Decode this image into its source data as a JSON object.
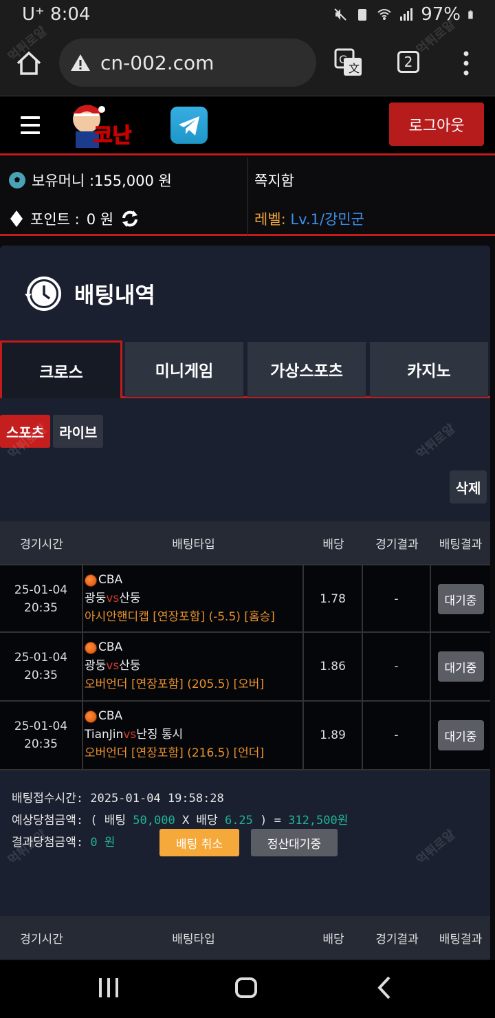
{
  "statusbar": {
    "carrier": "U⁺",
    "time": "8:04",
    "battery": "97%"
  },
  "browser": {
    "url": "cn-002.com",
    "tab_count": "2"
  },
  "header": {
    "logo_text": "코난",
    "logout_label": "로그아웃"
  },
  "user": {
    "money_label": "보유머니 :155,000 원",
    "messages_label": "쪽지함",
    "points_label": "포인트 :",
    "points_value": "0 원",
    "level_label": "레벨:",
    "level_value": "Lv.1/강민군"
  },
  "page": {
    "title": "배팅내역"
  },
  "tabs": [
    {
      "label": "크로스"
    },
    {
      "label": "미니게임"
    },
    {
      "label": "가상스포츠"
    },
    {
      "label": "카지노"
    }
  ],
  "subtabs": [
    {
      "label": "스포츠"
    },
    {
      "label": "라이브"
    }
  ],
  "delete_label": "삭제",
  "columns": [
    "경기시간",
    "배팅타입",
    "배당",
    "경기결과",
    "배팅결과"
  ],
  "bets": [
    {
      "date": "25-01-04",
      "time": "20:35",
      "league": "CBA",
      "home": "광둥",
      "vs": "vs",
      "away": "산둥",
      "bet": "아시안핸디캡 [연장포함] (-5.5) [홈승]",
      "odds": "1.78",
      "result": "-",
      "status": "대기중"
    },
    {
      "date": "25-01-04",
      "time": "20:35",
      "league": "CBA",
      "home": "광둥",
      "vs": "vs",
      "away": "산둥",
      "bet": "오버언더 [연장포함] (205.5) [오버]",
      "odds": "1.86",
      "result": "-",
      "status": "대기중"
    },
    {
      "date": "25-01-04",
      "time": "20:35",
      "league": "CBA",
      "home": "TianJin",
      "vs": "vs",
      "away": "난징 통시",
      "bet": "오버언더 [연장포함] (216.5) [언더]",
      "odds": "1.89",
      "result": "-",
      "status": "대기중"
    }
  ],
  "summary": {
    "accepted_label": "배팅접수시간: 2025-01-04 19:58:28",
    "expected_prefix": "예상당첨금액: ( 배팅 ",
    "stake": "50,000",
    "x_label": " X 배당 ",
    "total_odds": "6.25",
    "eq_label": " ) = ",
    "expected_win": "312,500원",
    "result_prefix": "결과당첨금액: ",
    "result_win": "0 원",
    "cancel_label": "배팅 취소",
    "settle_label": "정산대기중"
  },
  "watermark": "먹튀로얄"
}
